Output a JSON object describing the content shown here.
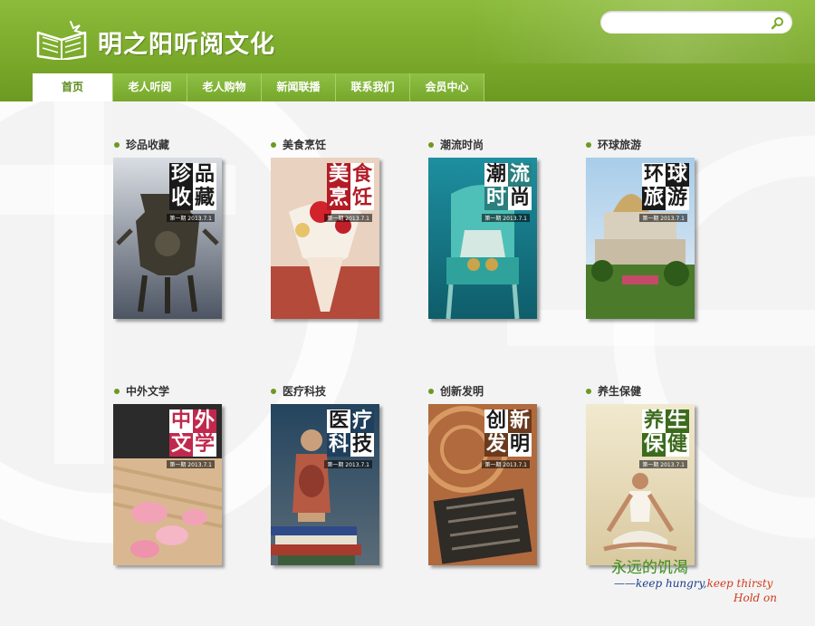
{
  "brand": {
    "name": "明之阳听阅文化",
    "logo_icon": "open-book-icon"
  },
  "search": {
    "value": "",
    "placeholder": "",
    "icon": "search-icon"
  },
  "nav": {
    "items": [
      {
        "label": "首页",
        "active": true
      },
      {
        "label": "老人听阅",
        "active": false
      },
      {
        "label": "老人购物",
        "active": false
      },
      {
        "label": "新闻联播",
        "active": false
      },
      {
        "label": "联系我们",
        "active": false
      },
      {
        "label": "会员中心",
        "active": false
      }
    ]
  },
  "categories": [
    {
      "label": "珍品收藏",
      "cover_title": [
        "珍",
        "品",
        "收",
        "藏"
      ],
      "issue": "第一期 2013.7.1"
    },
    {
      "label": "美食烹饪",
      "cover_title": [
        "美",
        "食",
        "烹",
        "饪"
      ],
      "issue": "第一期 2013.7.1"
    },
    {
      "label": "潮流时尚",
      "cover_title": [
        "潮",
        "流",
        "时",
        "尚"
      ],
      "issue": "第一期 2013.7.1"
    },
    {
      "label": "环球旅游",
      "cover_title": [
        "环",
        "球",
        "旅",
        "游"
      ],
      "issue": "第一期 2013.7.1"
    },
    {
      "label": "中外文学",
      "cover_title": [
        "中",
        "外",
        "文",
        "学"
      ],
      "issue": "第一期 2013.7.1"
    },
    {
      "label": "医疗科技",
      "cover_title": [
        "医",
        "疗",
        "科",
        "技"
      ],
      "issue": "第一期 2013.7.1"
    },
    {
      "label": "创新发明",
      "cover_title": [
        "创",
        "新",
        "发",
        "明"
      ],
      "issue": "第一期 2013.7.1"
    },
    {
      "label": "养生保健",
      "cover_title": [
        "养",
        "生",
        "保",
        "健"
      ],
      "issue": "第一期 2013.7.1"
    }
  ],
  "slogan": {
    "cn": "永远的饥渴",
    "en_part1": "——keep hungry,",
    "en_part2": "keep thirsty",
    "en_line2": "Hold on"
  },
  "colors": {
    "brand_green": "#7bab2c",
    "active_tab_text": "#5a8a18",
    "slogan_green": "#3a8d18",
    "slogan_blue": "#1b3d8c",
    "slogan_red": "#d23a1e"
  }
}
